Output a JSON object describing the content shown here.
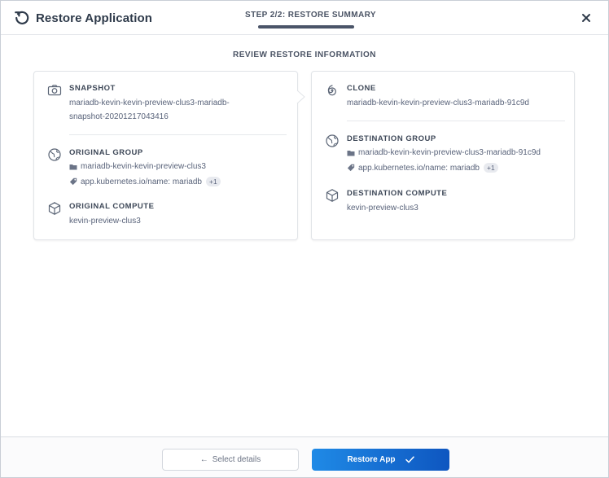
{
  "header": {
    "title": "Restore Application",
    "step": "STEP 2/2: RESTORE SUMMARY"
  },
  "review_heading": "REVIEW RESTORE INFORMATION",
  "left_card": {
    "snapshot": {
      "title": "SNAPSHOT",
      "value_line1": "mariadb-kevin-kevin-preview-clus3-mariadb-",
      "value_line2": "snapshot-20201217043416"
    },
    "original_group": {
      "title": "ORIGINAL GROUP",
      "namespace": "mariadb-kevin-kevin-preview-clus3",
      "label": "app.kubernetes.io/name: mariadb",
      "extra_count": "+1"
    },
    "original_compute": {
      "title": "ORIGINAL COMPUTE",
      "value": "kevin-preview-clus3"
    }
  },
  "right_card": {
    "clone": {
      "title": "CLONE",
      "value": "mariadb-kevin-kevin-preview-clus3-mariadb-91c9d"
    },
    "destination_group": {
      "title": "DESTINATION GROUP",
      "namespace": "mariadb-kevin-kevin-preview-clus3-mariadb-91c9d",
      "label": "app.kubernetes.io/name: mariadb",
      "extra_count": "+1"
    },
    "destination_compute": {
      "title": "DESTINATION COMPUTE",
      "value": "kevin-preview-clus3"
    }
  },
  "footer": {
    "back_label": "Select details",
    "back_arrow": "←",
    "restore_label": "Restore App"
  },
  "icons": {
    "title": "restore-icon",
    "close": "close-icon",
    "snapshot": "camera-icon",
    "group": "globe-icon",
    "compute": "cube-icon",
    "clone": "clone-spiral-icon",
    "folder": "folder-icon",
    "tag": "tag-icon",
    "check": "check-icon"
  },
  "colors": {
    "primary_start": "#1f8ae6",
    "primary_end": "#0e56c0",
    "text": "#3c4656",
    "muted": "#59637a"
  }
}
